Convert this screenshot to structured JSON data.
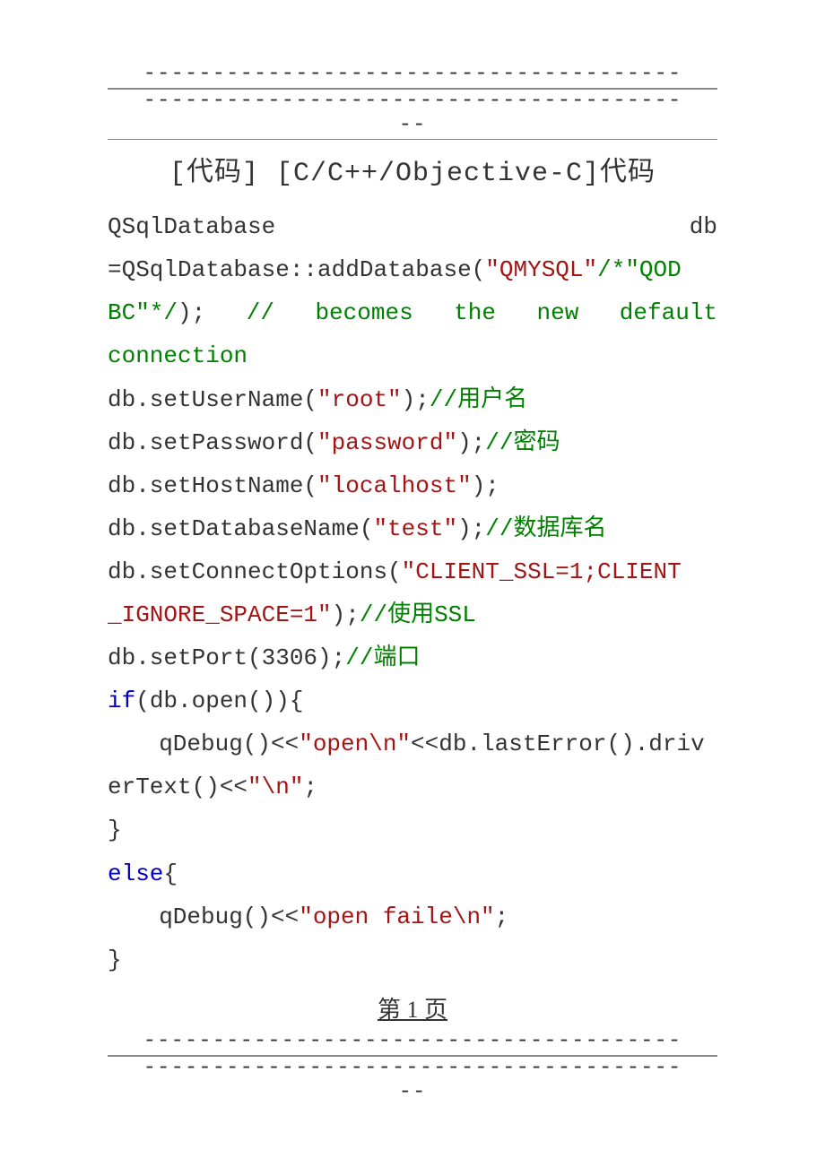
{
  "dashes": {
    "line": "---------------------------------------",
    "tail": "--"
  },
  "heading": "[代码] [C/C++/Objective-C]代码",
  "code": {
    "l1_a": "QSqlDatabase",
    "l1_b": "db",
    "l2_a": "=QSqlDatabase::addDatabase(",
    "l2_s1": "\"QMYSQL\"",
    "l2_c1": "/*\"QOD",
    "l3_c": "BC\"*/",
    "l3_a": ");",
    "l3_cm": "//",
    "l3_b": "becomes",
    "l3_d": "the",
    "l3_e": "new",
    "l3_f": "default",
    "l4_c": "connection",
    "l5_a": "db.setUserName(",
    "l5_s": "\"root\"",
    "l5_b": ");",
    "l5_c": "//用户名",
    "l6_a": "db.setPassword(",
    "l6_s": "\"password\"",
    "l6_b": ");",
    "l6_c": "//密码",
    "l7_a": "db.setHostName(",
    "l7_s": "\"localhost\"",
    "l7_b": ");",
    "l8_a": "db.setDatabaseName(",
    "l8_s": "\"test\"",
    "l8_b": ");",
    "l8_c": "//数据库名",
    "l9_a": "db.setConnectOptions(",
    "l9_s": "\"CLIENT_SSL=1;CLIENT",
    "l10_s": "_IGNORE_SPACE=1\"",
    "l10_a": ");",
    "l10_c": "//使用SSL",
    "l11_a": "db.setPort(3306);",
    "l11_c": "//端口",
    "l12_k": "if",
    "l12_a": "(db.open()){",
    "l13_a": "qDebug()<<",
    "l13_s": "\"open\\n\"",
    "l13_b": "<<db.lastError().driv",
    "l14_a": "erText()<<",
    "l14_s": "\"\\n\"",
    "l14_b": ";",
    "l15_a": "}",
    "l16_k": "else",
    "l16_a": "{",
    "l17_a": "qDebug()<<",
    "l17_s": "\"open faile\\n\"",
    "l17_b": ";",
    "l18_a": "}"
  },
  "footer": {
    "page": "第 1 页"
  }
}
